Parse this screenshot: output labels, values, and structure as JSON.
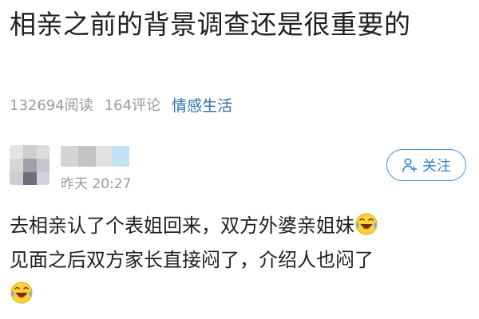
{
  "article": {
    "title": "相亲之前的背景调查还是很重要的",
    "views": "132694阅读",
    "comments": "164评论",
    "category": "情感生活"
  },
  "author": {
    "name_blurred": true,
    "timestamp": "昨天 20:27",
    "follow_label": "关注"
  },
  "comment": {
    "line1": "去相亲认了个表姐回来，双方外婆亲姐妹",
    "line2": "见面之后双方家长直接闷了，介绍人也闷了",
    "emoji_icon": "laugh-cry-emoji"
  },
  "colors": {
    "accent": "#3a7fcf",
    "meta_gray": "#9a9a9a",
    "category_blue": "#2f6fb6"
  }
}
